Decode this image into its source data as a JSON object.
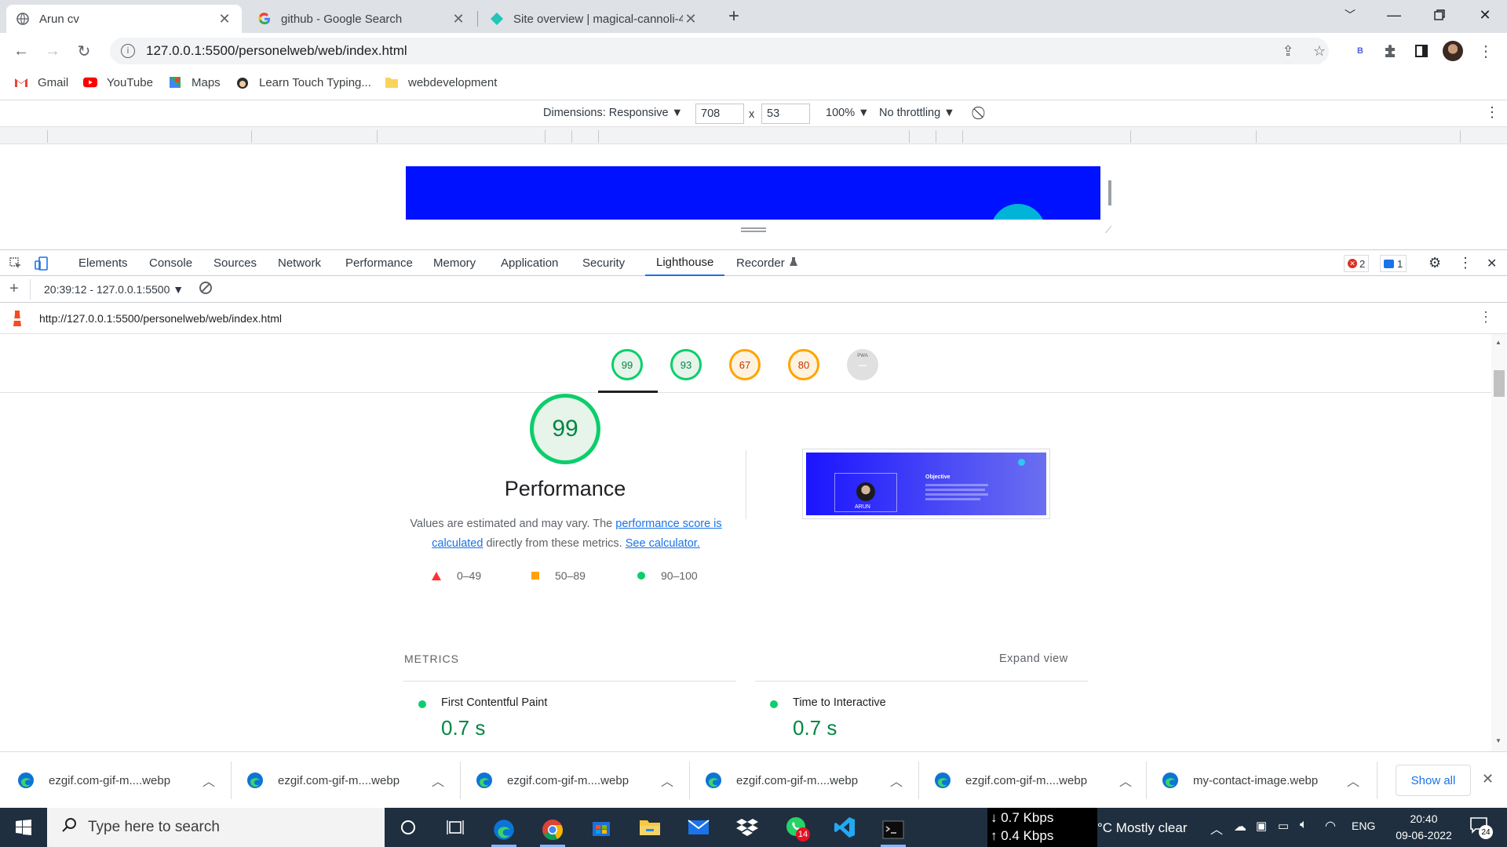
{
  "tabs": [
    {
      "title": "Arun cv",
      "active": true
    },
    {
      "title": "github - Google Search",
      "active": false
    },
    {
      "title": "Site overview | magical-cannoli-4",
      "active": false
    }
  ],
  "address": {
    "url": "127.0.0.1:5500/personelweb/web/index.html"
  },
  "bookmarks": [
    "Gmail",
    "YouTube",
    "Maps",
    "Learn Touch Typing...",
    "webdevelopment"
  ],
  "device_toolbar": {
    "dimensions_label": "Dimensions: Responsive ▼",
    "width": "708",
    "times": "x",
    "height": "53",
    "zoom": "100% ▼",
    "throttling": "No throttling ▼"
  },
  "devtools": {
    "tabs": [
      "Elements",
      "Console",
      "Sources",
      "Network",
      "Performance",
      "Memory",
      "Application",
      "Security",
      "Lighthouse",
      "Recorder"
    ],
    "active_tab": "Lighthouse",
    "errors_count": "2",
    "messages_count": "1",
    "report_selector": "20:39:12 - 127.0.0.1:5500 ▼",
    "report_url": "http://127.0.0.1:5500/personelweb/web/index.html"
  },
  "lighthouse": {
    "summary_scores": [
      {
        "score": "99",
        "color": "green",
        "value": 99
      },
      {
        "score": "93",
        "color": "green",
        "value": 93
      },
      {
        "score": "67",
        "color": "orange",
        "value": 67
      },
      {
        "score": "80",
        "color": "orange",
        "value": 80
      },
      {
        "score": "–",
        "color": "grey",
        "value": 0,
        "top_label": "PWA"
      }
    ],
    "main_score": "99",
    "main_score_value": 99,
    "category_title": "Performance",
    "desc_prefix": "Values are estimated and may vary. The ",
    "desc_link1": "performance score is calculated",
    "desc_mid": " directly from these metrics. ",
    "desc_link2": "See calculator.",
    "legend": [
      {
        "range": "0–49",
        "color": "#ff3333"
      },
      {
        "range": "50–89",
        "color": "#ffa400"
      },
      {
        "range": "90–100",
        "color": "#0cce6b"
      }
    ],
    "screenshot": {
      "heading": "Objective",
      "name": "ARUN"
    },
    "metrics_title": "METRICS",
    "expand_view": "Expand view",
    "metrics": [
      {
        "label": "First Contentful Paint",
        "value": "0.7 s"
      },
      {
        "label": "Time to Interactive",
        "value": "0.7 s"
      }
    ]
  },
  "downloads": [
    "ezgif.com-gif-m....webp",
    "ezgif.com-gif-m....webp",
    "ezgif.com-gif-m....webp",
    "ezgif.com-gif-m....webp",
    "ezgif.com-gif-m....webp",
    "my-contact-image.webp"
  ],
  "show_all": "Show all",
  "taskbar": {
    "search_placeholder": "Type here to search",
    "whatsapp_badge": "14",
    "net_down": "↓ 0.7 Kbps",
    "net_up": "↑ 0.4 Kbps",
    "weather": "°C  Mostly clear",
    "lang": "ENG",
    "time": "20:40",
    "date": "09-06-2022",
    "notif_count": "24"
  }
}
